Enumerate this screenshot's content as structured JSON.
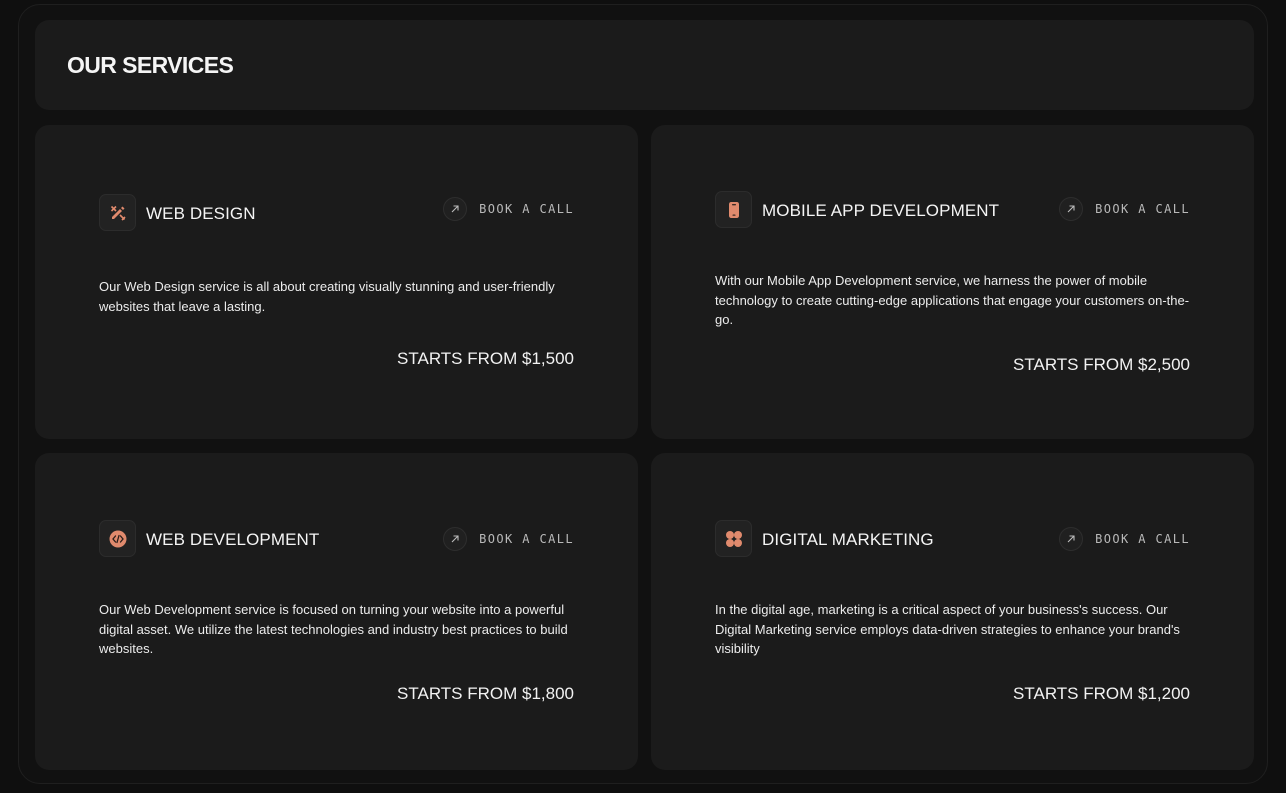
{
  "header": {
    "title": "OUR SERVICES"
  },
  "colors": {
    "accent": "#e08a6d",
    "background": "#0f0f0f",
    "card": "#1b1b1b"
  },
  "services": [
    {
      "icon": "design-pencil-icon",
      "title": "WEB DESIGN",
      "cta": "BOOK A CALL",
      "description": "Our Web Design service is all about creating visually stunning and user-friendly websites that leave a lasting.",
      "price": "STARTS FROM $1,500"
    },
    {
      "icon": "mobile-phone-icon",
      "title": "MOBILE APP DEVELOPMENT",
      "cta": "BOOK A CALL",
      "description": "With our Mobile App Development service, we harness the power of mobile technology to create cutting-edge applications that engage your customers on-the-go.",
      "price": "STARTS FROM $2,500"
    },
    {
      "icon": "code-icon",
      "title": "WEB DEVELOPMENT",
      "cta": "BOOK A CALL",
      "description": "Our Web Development service is focused on turning your website into a powerful digital asset. We utilize the latest technologies and industry best practices to build websites.",
      "price": "STARTS FROM $1,800"
    },
    {
      "icon": "grid-dots-icon",
      "title": "DIGITAL MARKETING",
      "cta": "BOOK A CALL",
      "description": "In the digital age, marketing is a critical aspect of your business's success. Our Digital Marketing service employs data-driven strategies to enhance your brand's visibility",
      "price": "STARTS FROM $1,200"
    }
  ]
}
